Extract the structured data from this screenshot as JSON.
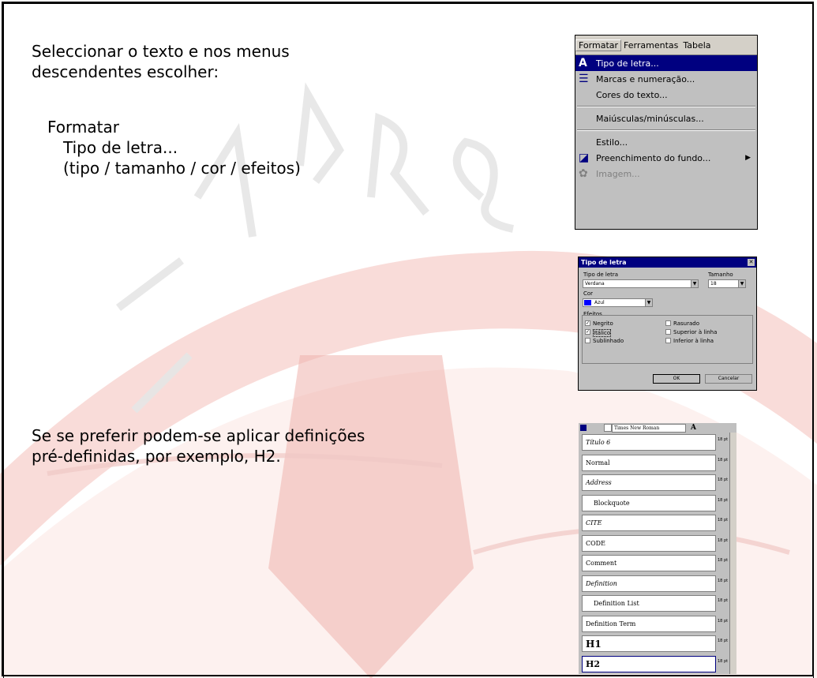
{
  "instructions": {
    "line1": "Seleccionar o texto e nos menus",
    "line2": "descendentes escolher:",
    "path_menu": "Formatar",
    "path_item": "Tipo de letra...",
    "path_options": "(tipo / tamanho / cor / efeitos)",
    "alt_line1": "Se se preferir podem-se aplicar definições",
    "alt_line2": "pré-definidas, por exemplo, H2."
  },
  "menu": {
    "bar": [
      "Formatar",
      "Ferramentas",
      "Tabela"
    ],
    "items": {
      "tipo": "Tipo de letra...",
      "marcas": "Marcas e numeração...",
      "cores": "Cores do texto...",
      "maiusculas": "Maiúsculas/minúsculas...",
      "estilo": "Estilo...",
      "preenchimento": "Preenchimento do fundo...",
      "imagem": "Imagem..."
    }
  },
  "dialog": {
    "title": "Tipo de letra",
    "font_label": "Tipo de letra",
    "font_value": "Verdana",
    "size_label": "Tamanho",
    "size_value": "18",
    "color_label": "Cor",
    "color_value": "Azul",
    "effects_label": "Efeitos",
    "effects": {
      "negrito": "Negrito",
      "italico": "Itálico",
      "sublinhado": "Sublinhado",
      "rasurado": "Rasurado",
      "superior": "Superior à linha",
      "inferior": "Inferior à linha"
    },
    "ok": "OK",
    "cancel": "Cancelar",
    "color_swatch": "#0000ff"
  },
  "styles_panel": {
    "font_value": "Times New Roman",
    "styles": [
      "Título 6",
      "Normal",
      "Address",
      "Blockquote",
      "CITE",
      "CODE",
      "Comment",
      "Definition",
      "Definition List",
      "Definition Term",
      "H1",
      "H2"
    ],
    "size_label": "18 pt"
  }
}
